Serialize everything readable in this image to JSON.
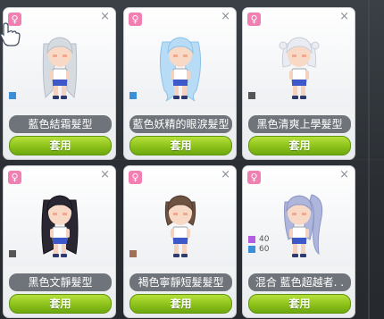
{
  "cards": [
    {
      "name": "藍色結霜髮型",
      "button": "套用",
      "gender": "♀",
      "hair_color": "#d6dbe2",
      "hair_shade": "#b7bec8",
      "swatches": [
        {
          "color": "#3a8fd8",
          "value": ""
        }
      ]
    },
    {
      "name": "藍色妖精的眼淚髮型",
      "button": "套用",
      "gender": "♀",
      "hair_color": "#b8dcf5",
      "hair_shade": "#8cc2e8",
      "swatches": [
        {
          "color": "#3a8fd8",
          "value": ""
        }
      ]
    },
    {
      "name": "黑色清爽上學髮型",
      "button": "套用",
      "gender": "♀",
      "hair_color": "#e9ecf2",
      "hair_shade": "#c9ced8",
      "swatches": [
        {
          "color": "#555555",
          "value": ""
        }
      ]
    },
    {
      "name": "黑色文靜髮型",
      "button": "套用",
      "gender": "♀",
      "hair_color": "#2a2733",
      "hair_shade": "#15131a",
      "swatches": [
        {
          "color": "#555555",
          "value": ""
        }
      ]
    },
    {
      "name": "褐色寧靜短髮髮型",
      "button": "套用",
      "gender": "♀",
      "hair_color": "#6e5242",
      "hair_shade": "#4f3a2f",
      "swatches": [
        {
          "color": "#a0705a",
          "value": ""
        }
      ]
    },
    {
      "name": "混合 藍色超越者. .",
      "button": "套用",
      "gender": "♀",
      "hair_color": "#aeb6dc",
      "hair_shade": "#8c94c4",
      "swatches": [
        {
          "color": "#b35de0",
          "value": "40"
        },
        {
          "color": "#3a8fd8",
          "value": "60"
        }
      ]
    }
  ],
  "icons": {
    "close": "close-icon",
    "gender": "female-icon",
    "cursor": "hand-pointer-icon"
  }
}
